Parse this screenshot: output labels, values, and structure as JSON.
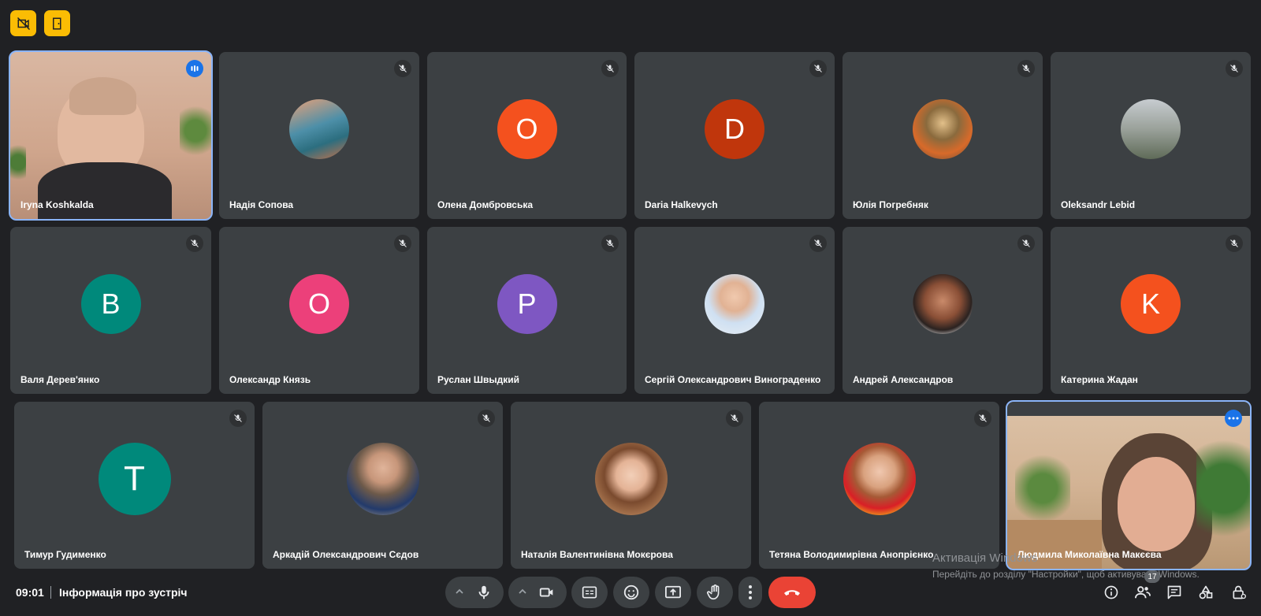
{
  "participants": {
    "row1": [
      {
        "name": "Iryna Koshkalda"
      },
      {
        "name": "Надія Сопова"
      },
      {
        "name": "Олена Домбровська",
        "initial": "O"
      },
      {
        "name": "Daria Halkevych",
        "initial": "D"
      },
      {
        "name": "Юлія Погребняк"
      },
      {
        "name": "Oleksandr Lebid"
      }
    ],
    "row2": [
      {
        "name": "Валя Дерев'янко",
        "initial": "B"
      },
      {
        "name": "Олександр Князь",
        "initial": "O"
      },
      {
        "name": "Руслан Швыдкий",
        "initial": "P"
      },
      {
        "name": "Сергій Олександрович Винограденко"
      },
      {
        "name": "Андрей Александров"
      },
      {
        "name": "Катерина Жадан",
        "initial": "K"
      }
    ],
    "row3": [
      {
        "name": "Тимур Гудименко",
        "initial": "T"
      },
      {
        "name": "Аркадій Олександрович Сєдов"
      },
      {
        "name": "Наталія Валентинівна Мокєрова"
      },
      {
        "name": "Тетяна Володимирівна Анопрієнко"
      },
      {
        "name": "Людмила Миколаївна Макєєва"
      }
    ]
  },
  "colors": {
    "orange": "#f4511e",
    "rust": "#c0360c",
    "teal": "#00897b",
    "pink": "#ec407a",
    "purple": "#7e57c2",
    "end_call": "#ea4335",
    "badge_yellow": "#fbbc04"
  },
  "bottom_bar": {
    "time": "09:01",
    "meeting_info": "Інформація про зустріч",
    "participant_count": "17"
  },
  "watermark": {
    "title": "Активація Windows",
    "subtitle": "Перейдіть до розділу \"Настройки\", щоб активувати Windows."
  },
  "icons": [
    "mic-off-icon",
    "mic-icon",
    "camera-icon",
    "captions-icon",
    "emoji-icon",
    "present-icon",
    "raise-hand-icon",
    "more-options-icon",
    "end-call-icon",
    "info-icon",
    "people-icon",
    "chat-icon",
    "activities-icon",
    "host-controls-icon"
  ]
}
